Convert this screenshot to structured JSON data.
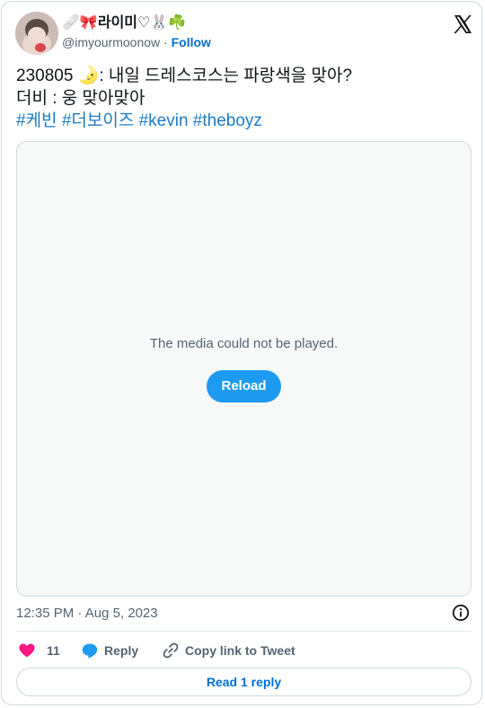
{
  "header": {
    "display_name": "🩹🎀라이미♡🐰☘️",
    "handle": "@imyourmoonow",
    "separator": "·",
    "follow_label": "Follow"
  },
  "tweet": {
    "line1": "230805 🌛: 내일 드레스코스는 파랑색을 맞아?",
    "line2": "더비 : 웅 맞아맞아",
    "hashtags": [
      "#케빈",
      "#더보이즈",
      "#kevin",
      "#theboyz"
    ]
  },
  "media": {
    "message": "The media could not be played.",
    "reload_label": "Reload"
  },
  "meta": {
    "timestamp": "12:35 PM · Aug 5, 2023"
  },
  "actions": {
    "like_count": "11",
    "reply_label": "Reply",
    "copy_label": "Copy link to Tweet"
  },
  "footer": {
    "read_replies_label": "Read 1 reply"
  },
  "colors": {
    "accent": "#1d9bf0",
    "link": "#006fd6",
    "hashtag": "#1d7bc6",
    "like": "#f91880",
    "muted": "#536471",
    "border": "#cfd9de"
  }
}
